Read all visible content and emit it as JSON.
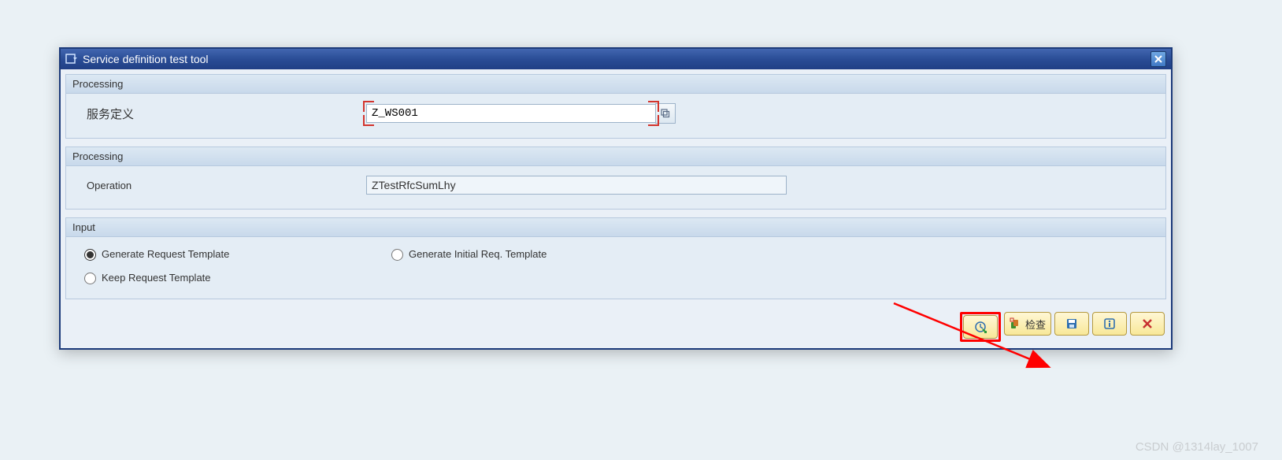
{
  "dialog": {
    "title": "Service definition test tool"
  },
  "group1": {
    "header": "Processing",
    "label": "服务定义",
    "value": "Z_WS001"
  },
  "group2": {
    "header": "Processing",
    "label": "Operation",
    "value": "ZTestRfcSumLhy"
  },
  "group3": {
    "header": "Input",
    "options": {
      "opt1": "Generate Request Template",
      "opt2": "Generate Initial Req. Template",
      "opt3": "Keep Request Template"
    }
  },
  "footer": {
    "check_label": "检查"
  },
  "watermark": "CSDN @1314lay_1007"
}
